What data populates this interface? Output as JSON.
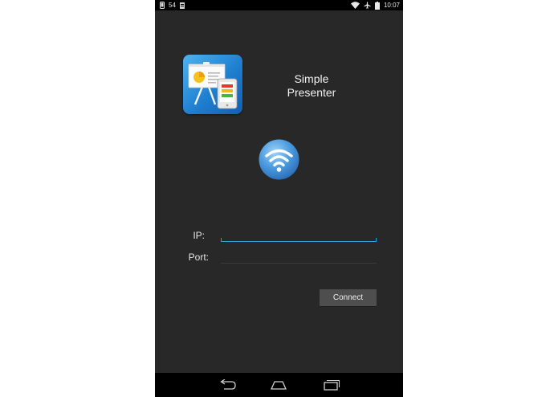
{
  "status_bar": {
    "left_text": "54",
    "time": "10:07",
    "icons": [
      "phone-icon",
      "notification-icon",
      "wifi-icon",
      "airplane-mode-icon",
      "battery-icon"
    ]
  },
  "app": {
    "title_line1": "Simple",
    "title_line2": "Presenter",
    "icon": "presentation-app-icon",
    "connection_icon": "wifi-icon"
  },
  "form": {
    "ip_label": "IP:",
    "ip_value": "",
    "port_label": "Port:",
    "port_value": "",
    "connect_label": "Connect"
  },
  "nav_bar": {
    "icons": [
      "back-icon",
      "home-icon",
      "recents-icon"
    ]
  },
  "colors": {
    "background": "#282828",
    "accent": "#2a9fd6",
    "button": "#4e4e4e",
    "text": "#f2f2f2"
  }
}
